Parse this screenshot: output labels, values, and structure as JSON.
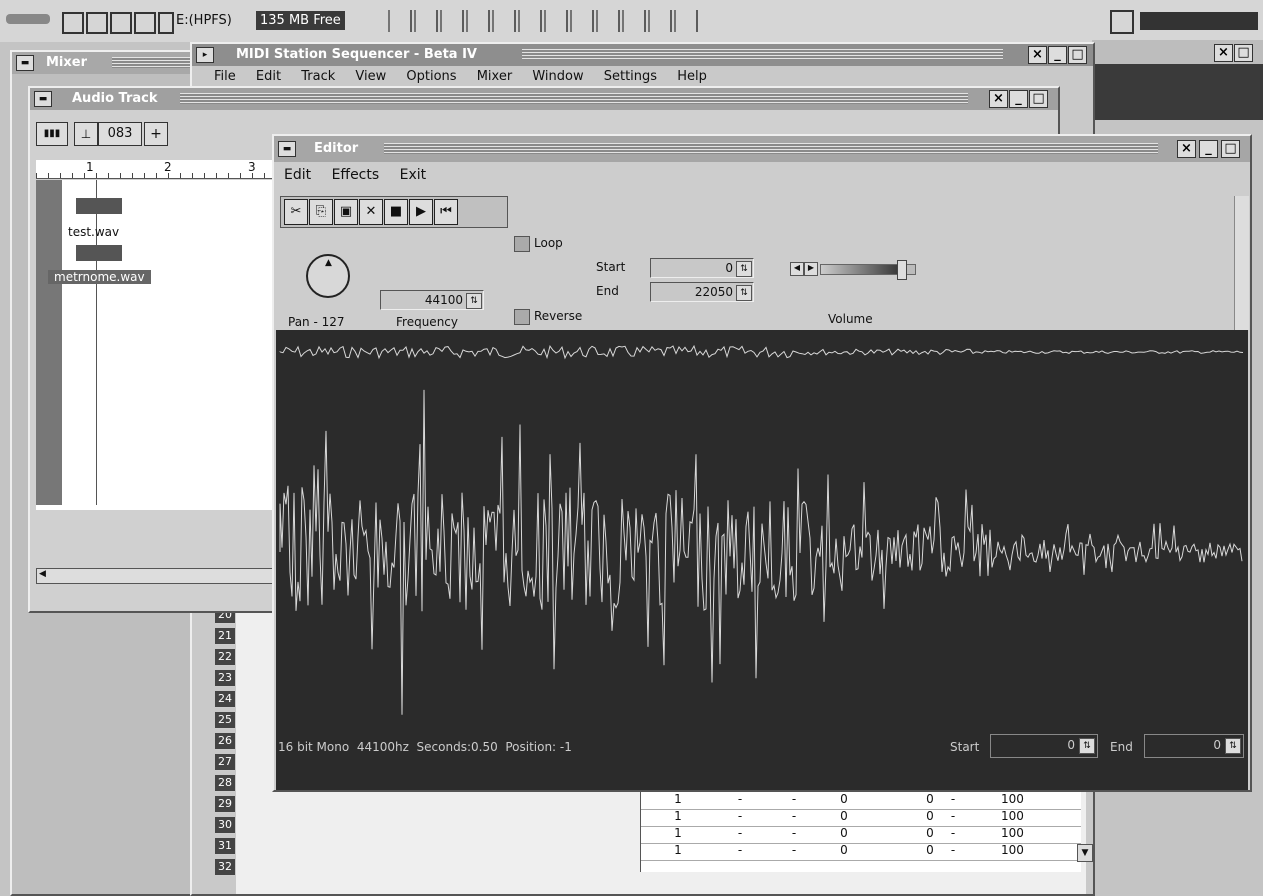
{
  "taskbar": {
    "drive": "E:(HPFS)",
    "free_space": "135 MB Free"
  },
  "mixer": {
    "title": "Mixer"
  },
  "sequencer": {
    "title": "MIDI Station Sequencer - Beta IV",
    "menu": [
      "File",
      "Edit",
      "Track",
      "View",
      "Options",
      "Mixer",
      "Window",
      "Settings",
      "Help"
    ]
  },
  "audio_track": {
    "title": "Audio Track",
    "counter": "083",
    "ruler": [
      "1",
      "2",
      "3"
    ],
    "clips": [
      {
        "label": "test.wav"
      },
      {
        "label": "metrnome.wav"
      }
    ]
  },
  "track_table": {
    "row_numbers": [
      "20",
      "21",
      "22",
      "23",
      "24",
      "25",
      "26",
      "27",
      "28",
      "29",
      "30",
      "31",
      "32"
    ],
    "rows": [
      {
        "ch": "1",
        "a": "-",
        "b": "-",
        "c": "0",
        "d": "0",
        "e": "-",
        "vol": "100"
      },
      {
        "ch": "1",
        "a": "-",
        "b": "-",
        "c": "0",
        "d": "0",
        "e": "-",
        "vol": "100"
      },
      {
        "ch": "1",
        "a": "-",
        "b": "-",
        "c": "0",
        "d": "0",
        "e": "-",
        "vol": "100"
      },
      {
        "ch": "1",
        "a": "-",
        "b": "-",
        "c": "0",
        "d": "0",
        "e": "-",
        "vol": "100"
      }
    ]
  },
  "editor": {
    "title": "Editor",
    "menu": [
      "Edit",
      "Effects",
      "Exit"
    ],
    "loop_label": "Loop",
    "reverse_label": "Reverse",
    "start_label": "Start",
    "end_label": "End",
    "start_value": "0",
    "end_value": "22050",
    "frequency_value": "44100",
    "pan_label": "Pan - 127",
    "frequency_label": "Frequency",
    "volume_label": "Volume",
    "volume_level": 0.85,
    "status": "16 bit Mono  44100hz  Seconds:0.50  Position: -1",
    "footer_start_label": "Start",
    "footer_start_value": "0",
    "footer_end_label": "End",
    "footer_end_value": "0",
    "colors": {
      "wave_bg": "#2b2b2b",
      "wave": "#d8d8d8"
    }
  }
}
